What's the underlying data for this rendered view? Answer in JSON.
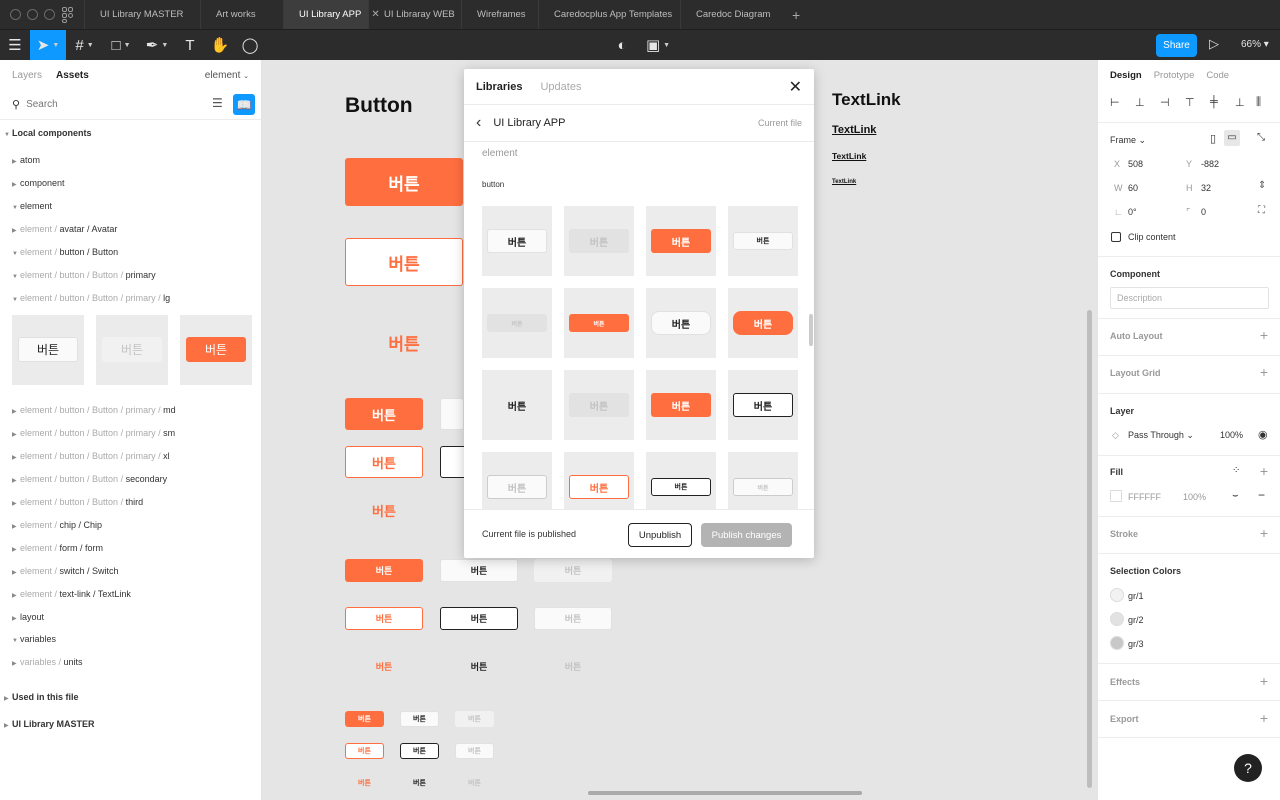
{
  "tabs": [
    "UI Library MASTER",
    "Art works",
    "UI Library APP",
    "UI Libraray WEB",
    "Wireframes",
    "Caredocplus App Templates",
    "Caredoc Diagram"
  ],
  "toolbar": {
    "share": "Share",
    "zoom": "66%"
  },
  "left": {
    "tab_layers": "Layers",
    "tab_assets": "Assets",
    "filter": "element",
    "search_placeholder": "Search",
    "local_components": "Local components",
    "items": [
      "atom",
      "component",
      "element"
    ],
    "paths": [
      [
        "element / ",
        "avatar / Avatar"
      ],
      [
        "element / ",
        "button / Button"
      ],
      [
        "element / button / Button / ",
        "primary"
      ],
      [
        "element / button / Button / primary / ",
        "lg"
      ],
      [
        "element / button / Button / primary / ",
        "md"
      ],
      [
        "element / button / Button / primary / ",
        "sm"
      ],
      [
        "element / button / Button / primary / ",
        "xl"
      ],
      [
        "element / button / Button / ",
        "secondary"
      ],
      [
        "element / button / Button / ",
        "third"
      ],
      [
        "element / ",
        "chip / Chip"
      ],
      [
        "element / ",
        "form / form"
      ],
      [
        "element / ",
        "switch / Switch"
      ],
      [
        "element / ",
        "text-link / TextLink"
      ]
    ],
    "layout": "layout",
    "variables": "variables",
    "units_prefix": "variables / ",
    "units": "units",
    "used": "Used in this file",
    "master": "UI Library MASTER",
    "thumb_label": "버튼"
  },
  "canvas": {
    "button_title": "Button",
    "btn": "버튼",
    "textlink_title": "TextLink",
    "textlink": "TextLink"
  },
  "modal": {
    "tab_libraries": "Libraries",
    "tab_updates": "Updates",
    "lib_name": "UI Library APP",
    "current_file": "Current file",
    "section": "element",
    "subsection": "button",
    "btn": "버튼",
    "footer_status": "Current file is published",
    "unpublish": "Unpublish",
    "publish": "Publish changes"
  },
  "right": {
    "tab_design": "Design",
    "tab_prototype": "Prototype",
    "tab_code": "Code",
    "frame": "Frame",
    "x_label": "X",
    "x": "508",
    "y_label": "Y",
    "y": "-882",
    "w_label": "W",
    "w": "60",
    "h_label": "H",
    "h": "32",
    "rot": "0°",
    "radius": "0",
    "clip": "Clip content",
    "component": "Component",
    "description_placeholder": "Description",
    "auto_layout": "Auto Layout",
    "layout_grid": "Layout Grid",
    "layer": "Layer",
    "blend": "Pass Through",
    "opacity": "100%",
    "fill": "Fill",
    "fill_hex": "FFFFFF",
    "fill_opacity": "100%",
    "stroke": "Stroke",
    "selection_colors": "Selection Colors",
    "colors": [
      "gr/1",
      "gr/2",
      "gr/3"
    ],
    "effects": "Effects",
    "export": "Export",
    "help": "?"
  }
}
